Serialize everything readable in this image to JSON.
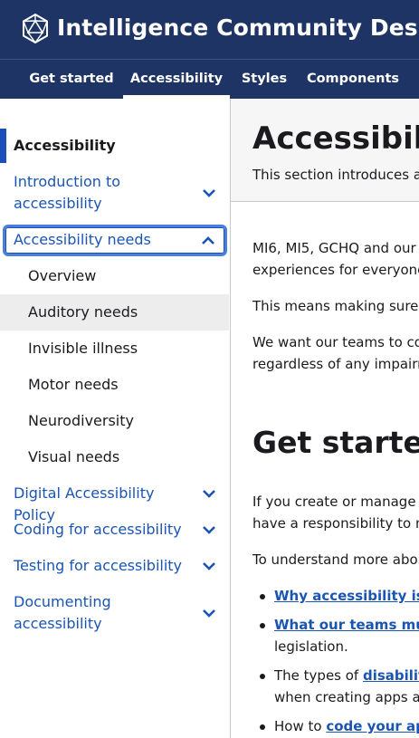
{
  "header": {
    "title": "Intelligence Community Design System",
    "logo_icon": "icosahedron-logo-icon"
  },
  "nav": {
    "items": [
      "Get started",
      "Accessibility",
      "Styles",
      "Components"
    ],
    "active": "Accessibility"
  },
  "sidebar": {
    "heading": "Accessibility",
    "sections": [
      {
        "label_line1": "Introduction to",
        "label_line2": "accessibility"
      },
      {
        "label": "Accessibility needs"
      },
      {
        "label": "Digital Accessibility Policy"
      },
      {
        "label": "Coding for accessibility"
      },
      {
        "label": "Testing for accessibility"
      },
      {
        "label_line1": "Documenting",
        "label_line2": "accessibility"
      }
    ],
    "subitems": [
      "Overview",
      "Auditory needs",
      "Invisible illness",
      "Motor needs",
      "Neurodiversity",
      "Visual needs"
    ]
  },
  "main": {
    "title": "Accessibility",
    "subtitle": "This section introduces a",
    "paragraphs": [
      {
        "line1": "MI6, MI5, GCHQ and our",
        "line2": "experiences for everyone"
      },
      {
        "line1": "This means making sure"
      },
      {
        "line1": "We want our teams to co",
        "line2": "regardless of any impairn"
      }
    ],
    "get_started_title": "Get started",
    "gs_paragraph": {
      "line1": "If you create or manage a",
      "line2": "have a responsibility to m"
    },
    "understand_text": "To understand more abo",
    "bullets": [
      {
        "link": "Why accessibility is"
      },
      {
        "link": "What our teams mu",
        "line2": "legislation."
      },
      {
        "prefix": "The types of ",
        "link": "disabilit",
        "line2": "when creating apps a"
      },
      {
        "prefix": "How to ",
        "link": "code your ap"
      }
    ]
  },
  "colors": {
    "header_bg": "#1d3464",
    "link": "#1a55b3",
    "accent": "#1d4fb8",
    "focus_ring": "#4a7fe0"
  }
}
